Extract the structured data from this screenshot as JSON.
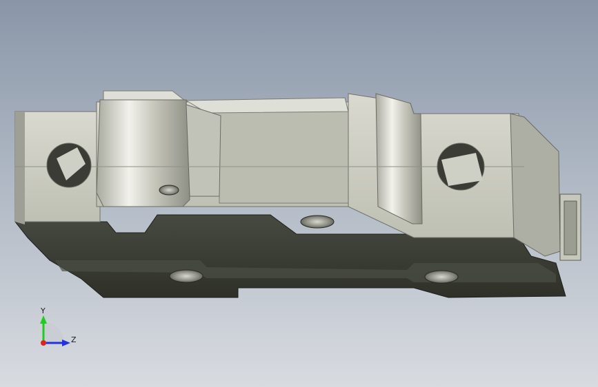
{
  "viewport": {
    "background_top": "#8a96a8",
    "background_bottom": "#d8dbe0"
  },
  "model": {
    "part": "cad-part-body",
    "body_color": "#c9c9bd",
    "base_color": "#3a3d33"
  },
  "triad": {
    "y_label": "Y",
    "z_label": "Z",
    "colors": {
      "y": "#1fcc1f",
      "z": "#2233dd",
      "x": "#dd2222"
    }
  }
}
